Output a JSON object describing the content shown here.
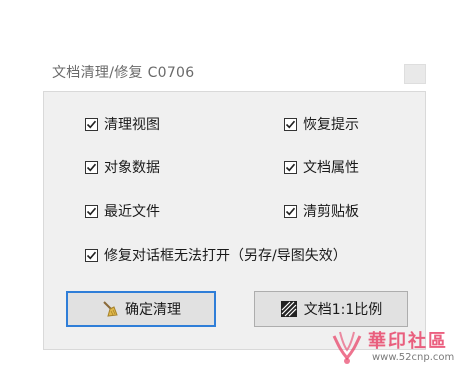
{
  "dialog": {
    "title": "文档清理/修复 C0706"
  },
  "options": [
    {
      "label": "清理视图",
      "checked": true
    },
    {
      "label": "恢复提示",
      "checked": true
    },
    {
      "label": "对象数据",
      "checked": true
    },
    {
      "label": "文档属性",
      "checked": true
    },
    {
      "label": "最近文件",
      "checked": true
    },
    {
      "label": "清剪贴板",
      "checked": true
    },
    {
      "label": "修复对话框无法打开（另存/导图失效）",
      "checked": true
    }
  ],
  "buttons": {
    "confirm_label": "确定清理",
    "confirm_icon": "broom-icon",
    "ratio_label": "文档1:1比例",
    "ratio_icon": "hatched-ratio-icon"
  },
  "watermark": {
    "name": "華印社區",
    "url": "www.52cnp.com"
  },
  "colors": {
    "panel_bg": "#f0f0f0",
    "focus_border": "#2f7ed8",
    "button_bg": "#e1e1e1",
    "watermark": "#e8456a"
  }
}
